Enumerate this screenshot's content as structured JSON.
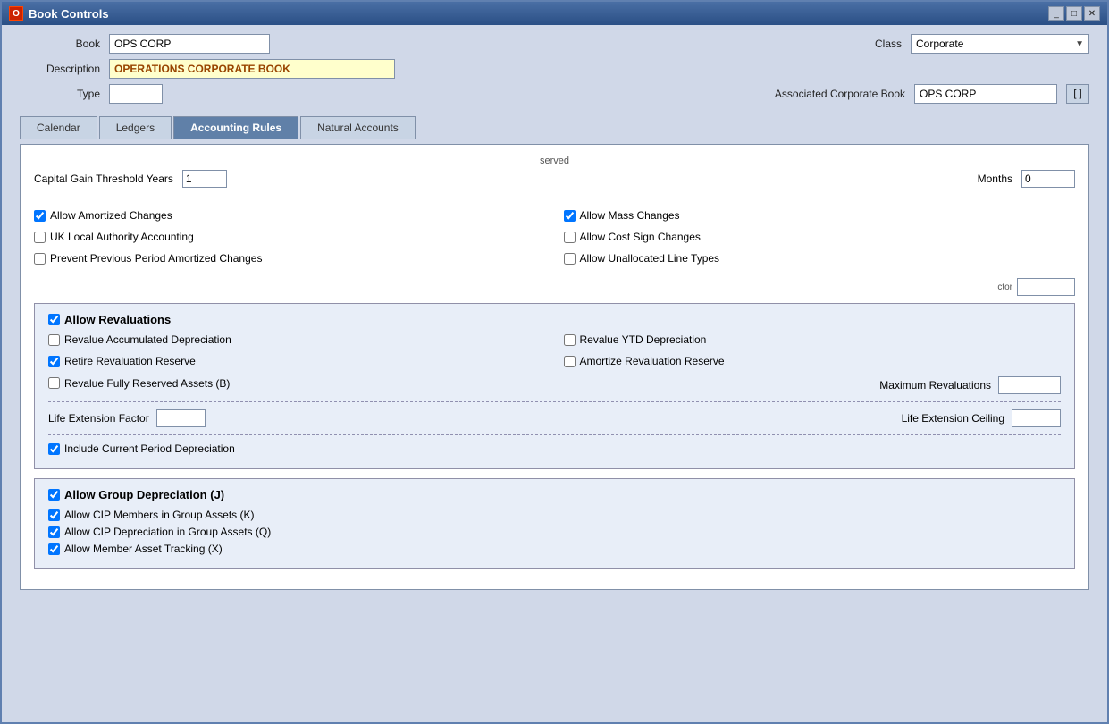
{
  "window": {
    "title": "Book Controls",
    "icon": "O"
  },
  "titleButtons": [
    "_",
    "□",
    "✕"
  ],
  "form": {
    "book_label": "Book",
    "book_value": "OPS CORP",
    "class_label": "Class",
    "class_value": "Corporate",
    "description_label": "Description",
    "description_value": "OPERATIONS CORPORATE BOOK",
    "type_label": "Type",
    "assoc_label": "Associated Corporate Book",
    "assoc_value": "OPS CORP"
  },
  "tabs": [
    {
      "id": "calendar",
      "label": "Calendar"
    },
    {
      "id": "ledgers",
      "label": "Ledgers"
    },
    {
      "id": "accounting-rules",
      "label": "Accounting Rules"
    },
    {
      "id": "natural-accounts",
      "label": "Natural Accounts"
    }
  ],
  "activeTab": "accounting-rules",
  "accountingRules": {
    "capitalGainLabel": "Capital Gain Threshold Years",
    "capitalGainYears": "1",
    "monthsLabel": "Months",
    "monthsValue": "0",
    "checkboxes": {
      "allowAmortizedChanges": {
        "label": "Allow Amortized Changes",
        "checked": true
      },
      "allowMassChanges": {
        "label": "Allow Mass Changes",
        "checked": true
      },
      "ukLocalAuthority": {
        "label": "UK Local Authority Accounting",
        "checked": false
      },
      "allowCostSignChanges": {
        "label": "Allow Cost Sign Changes",
        "checked": false
      },
      "preventPreviousPeriod": {
        "label": "Prevent Previous Period Amortized Changes",
        "checked": false
      },
      "allowUnallocatedLineTypes": {
        "label": "Allow Unallocated Line Types",
        "checked": false
      }
    },
    "ctorLabel": "ctor",
    "revaluations": {
      "sectionLabel": "Allow Revaluations",
      "checked": true,
      "items": {
        "revalueAccumDepr": {
          "label": "Revalue Accumulated Depreciation",
          "checked": false
        },
        "revalueYTDDepr": {
          "label": "Revalue YTD Depreciation",
          "checked": false
        },
        "retireRevalReserve": {
          "label": "Retire Revaluation Reserve",
          "checked": true
        },
        "amortizeRevalReserve": {
          "label": "Amortize Revaluation Reserve",
          "checked": false
        },
        "revalFullyReserved": {
          "label": "Revalue Fully Reserved Assets (B)",
          "checked": false
        }
      },
      "maxRevaluationsLabel": "Maximum Revaluations",
      "maxRevaluationsValue": "",
      "lifeExtFactorLabel": "Life Extension Factor",
      "lifeExtFactorValue": "",
      "lifeExtCeilingLabel": "Life Extension Ceiling",
      "lifeExtCeilingValue": "",
      "includeCurrentPeriodLabel": "Include Current Period Depreciation",
      "includeCurrentPeriodChecked": true
    },
    "groupDepreciation": {
      "sectionLabel": "Allow Group Depreciation (J)",
      "checked": true,
      "items": {
        "allowCIPMembers": {
          "label": "Allow CIP Members in Group Assets  (K)",
          "checked": true
        },
        "allowCIPDepreciation": {
          "label": "Allow CIP Depreciation in Group Assets (Q)",
          "checked": true
        },
        "allowMemberAssetTracking": {
          "label": "Allow Member Asset Tracking (X)",
          "checked": true
        }
      }
    }
  }
}
